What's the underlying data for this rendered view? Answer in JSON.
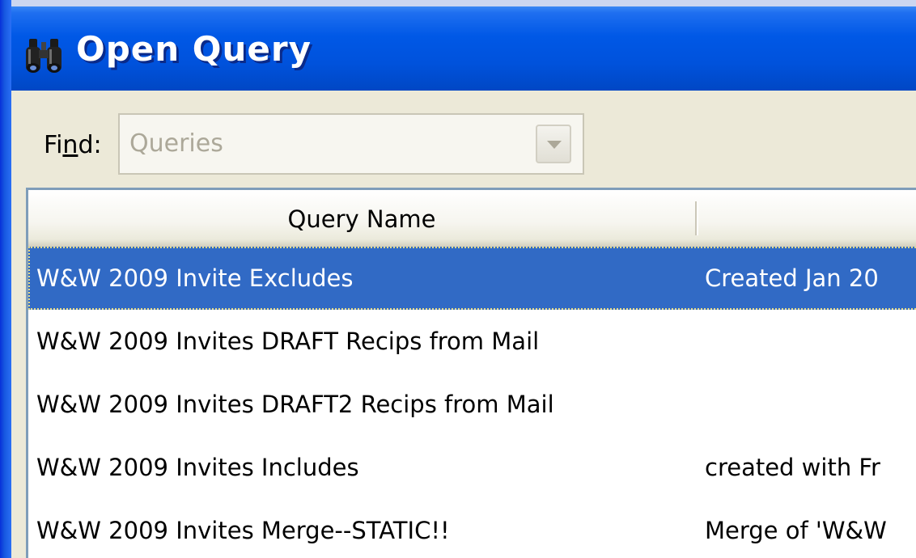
{
  "window": {
    "title": "Open Query",
    "title_icon": "binoculars-icon"
  },
  "find": {
    "label_prefix": "Fi",
    "label_underlined": "n",
    "label_suffix": "d:",
    "value": "Queries"
  },
  "list": {
    "columns": [
      {
        "label": "Query Name"
      },
      {
        "label": ""
      }
    ],
    "rows": [
      {
        "name": "W&W 2009 Invite Excludes",
        "description": "Created Jan 20",
        "selected": true
      },
      {
        "name": "W&W 2009 Invites DRAFT Recips from Mail",
        "description": "",
        "selected": false
      },
      {
        "name": "W&W 2009 Invites DRAFT2 Recips from Mail",
        "description": "",
        "selected": false
      },
      {
        "name": "W&W 2009 Invites Includes",
        "description": "created with Fr",
        "selected": false
      },
      {
        "name": "W&W 2009 Invites Merge--STATIC!!",
        "description": "Merge of 'W&W",
        "selected": false
      }
    ]
  },
  "colors": {
    "titlebar": "#0058e6",
    "selection": "#316ac5",
    "face": "#ece9d8"
  }
}
